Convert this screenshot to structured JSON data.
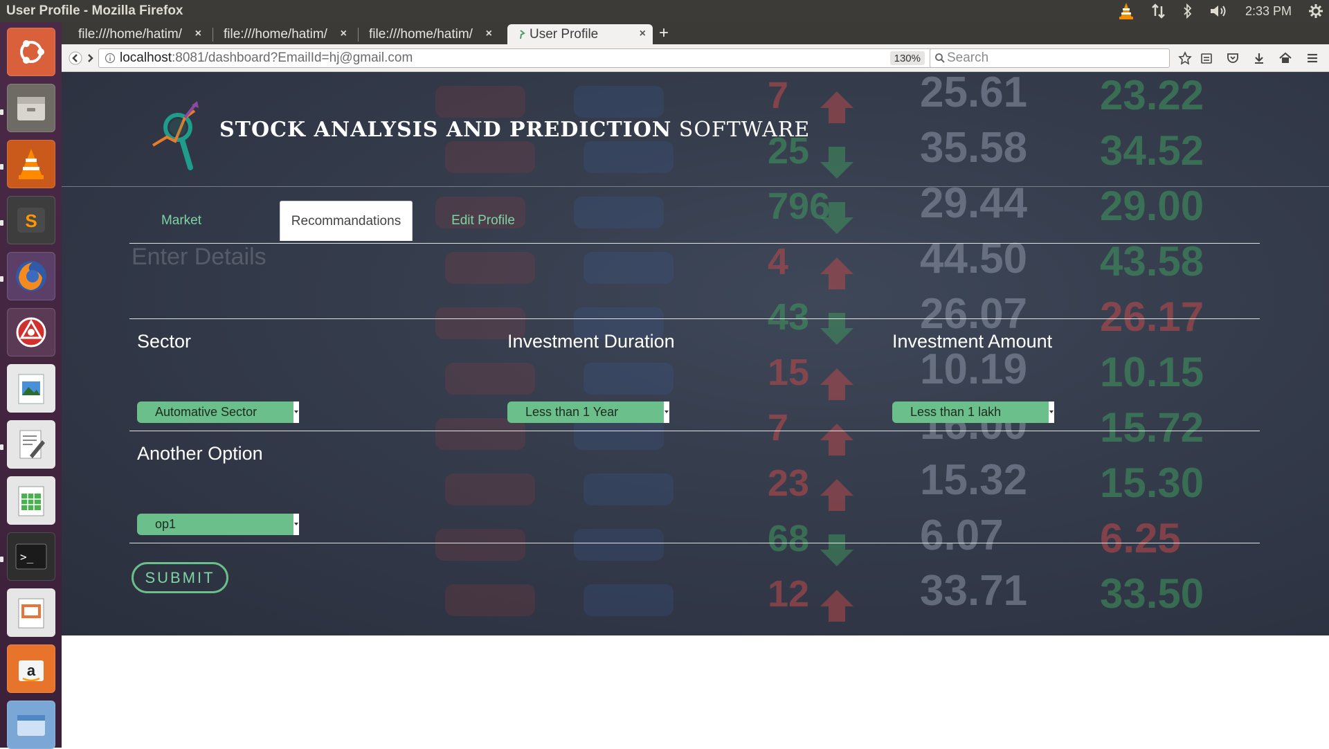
{
  "window": {
    "title": "User Profile - Mozilla Firefox"
  },
  "panel": {
    "clock": "2:33 PM"
  },
  "browser": {
    "tabs": [
      {
        "label": "file:///home/hatim/",
        "active": false
      },
      {
        "label": "file:///home/hatim/",
        "active": false
      },
      {
        "label": "file:///home/hatim/",
        "active": false
      },
      {
        "label": "User Profile",
        "active": true
      }
    ],
    "url_host": "localhost",
    "url_rest": ":8081/dashboard?EmailId=hj@gmail.com",
    "zoom": "130%",
    "search_placeholder": "Search"
  },
  "page": {
    "brand_bold": "STOCK ANALYSIS AND PREDICTION",
    "brand_light": "SOFTWARE",
    "tabs": [
      "Market",
      "Recommandations",
      "Edit Profile"
    ],
    "active_tab": "Recommandations",
    "section_title": "Enter Details",
    "form": {
      "sector": {
        "label": "Sector",
        "value": "Automative Sector"
      },
      "duration": {
        "label": "Investment Duration",
        "value": "Less than 1 Year"
      },
      "amount": {
        "label": "Investment Amount",
        "value": "Less than 1 lakh"
      },
      "other": {
        "label": "Another Option",
        "value": "op1"
      }
    },
    "submit_label": "SUBMIT"
  },
  "colors": {
    "accent_green": "#6bbf8a",
    "hero_dark": "#343b4b",
    "ticker_red": "#c24a4a",
    "ticker_green": "#3f9a5e"
  },
  "background_ticker": {
    "col_values": [
      "25.61",
      "35.58",
      "29.44",
      "44.50",
      "26.07",
      "10.19",
      "16.00",
      "15.32",
      "6.07",
      "33.71"
    ],
    "col_changes_1": [
      "7",
      "25",
      "796",
      "4",
      "43",
      "15",
      "7",
      "23",
      "68",
      "12"
    ],
    "col_green": [
      "23.22",
      "34.52",
      "29.00",
      "43.58",
      "26.17",
      "10.15",
      "15.72",
      "15.30",
      "6.25",
      "33.50"
    ]
  }
}
